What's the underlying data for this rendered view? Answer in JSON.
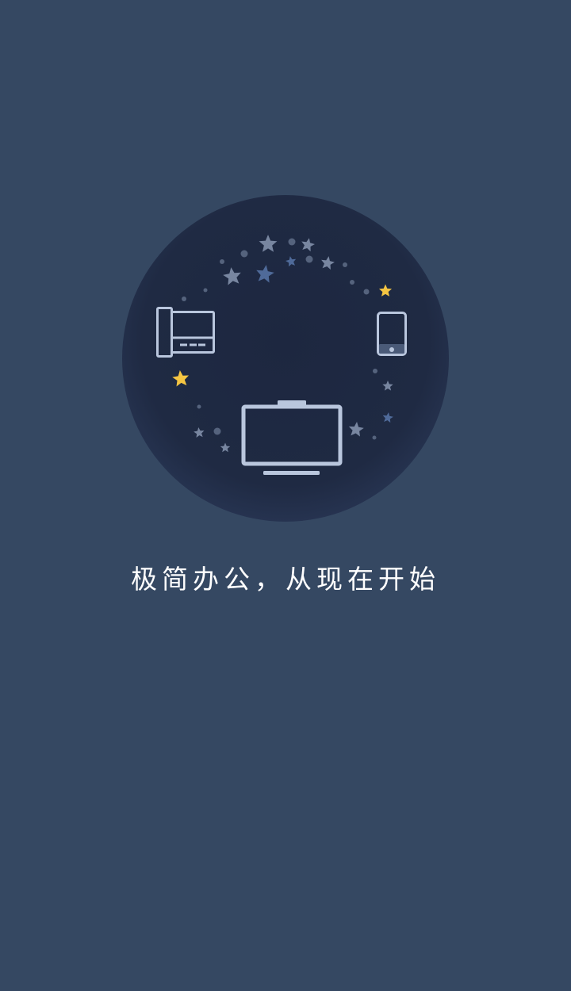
{
  "splash": {
    "slogan": "极简办公，从现在开始"
  },
  "colors": {
    "background": "#354862",
    "circle": "#1e2840",
    "device_stroke": "#b9c6dd",
    "star_accent": "#f5c542",
    "star_blue": "#4f6a99",
    "star_grey": "#7886a0"
  },
  "icons": {
    "desk-phone": "desk-phone-icon",
    "smartphone": "smartphone-icon",
    "monitor": "monitor-icon",
    "star": "star-icon"
  }
}
